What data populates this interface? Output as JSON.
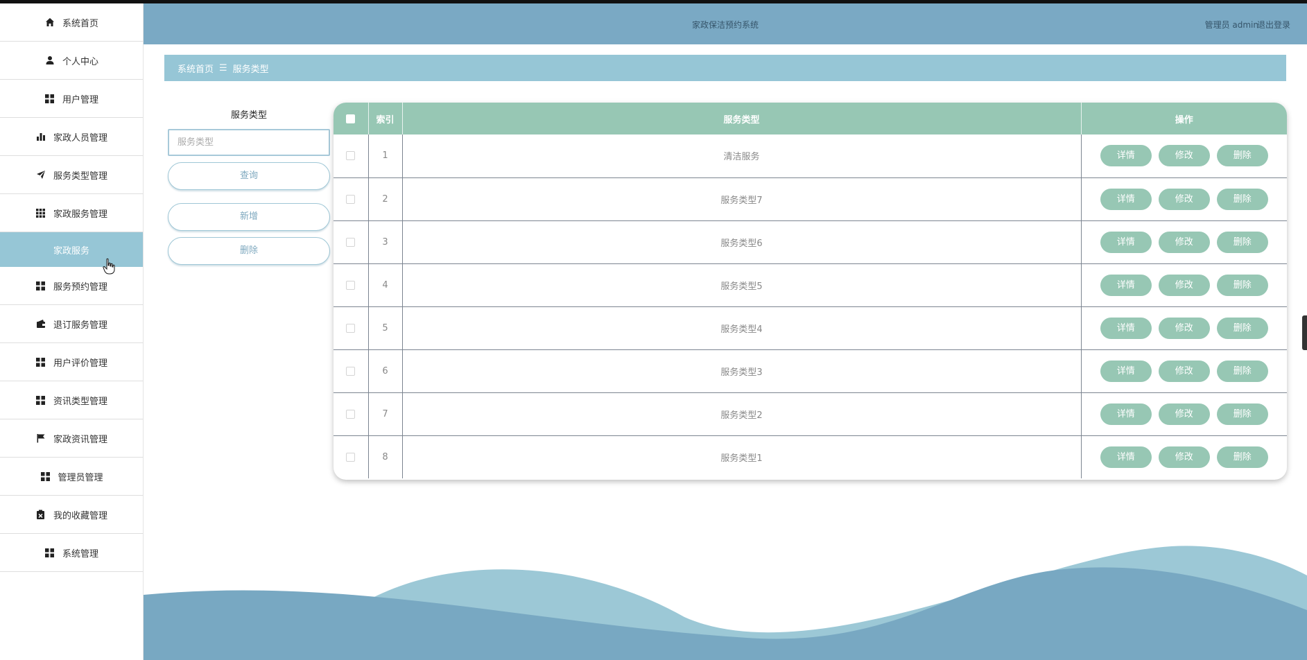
{
  "sidebar": {
    "items": [
      {
        "label": "系统首页",
        "icon": "home-icon"
      },
      {
        "label": "个人中心",
        "icon": "user-icon"
      },
      {
        "label": "用户管理",
        "icon": "grid-icon"
      },
      {
        "label": "家政人员管理",
        "icon": "bar-chart-icon"
      },
      {
        "label": "服务类型管理",
        "icon": "send-icon"
      },
      {
        "label": "家政服务管理",
        "icon": "grid9-icon"
      },
      {
        "label": "服务预约管理",
        "icon": "grid-icon"
      },
      {
        "label": "退订服务管理",
        "icon": "wallet-icon"
      },
      {
        "label": "用户评价管理",
        "icon": "grid-icon"
      },
      {
        "label": "资讯类型管理",
        "icon": "grid-icon"
      },
      {
        "label": "家政资讯管理",
        "icon": "flag-icon"
      },
      {
        "label": "管理员管理",
        "icon": "grid-icon"
      },
      {
        "label": "我的收藏管理",
        "icon": "clipboard-icon"
      },
      {
        "label": "系统管理",
        "icon": "grid-icon"
      }
    ],
    "submenu": {
      "label": "家政服务"
    }
  },
  "header": {
    "title": "家政保洁预约系统",
    "user": "管理员 admin",
    "logout": "退出登录"
  },
  "breadcrumb": {
    "home": "系统首页",
    "separator": "☰",
    "current": "服务类型"
  },
  "search": {
    "label": "服务类型",
    "placeholder": "服务类型",
    "query_label": "查询",
    "add_label": "新增",
    "delete_label": "删除"
  },
  "table": {
    "headers": {
      "index": "索引",
      "type": "服务类型",
      "actions": "操作"
    },
    "rows": [
      {
        "index": "1",
        "type": "清洁服务"
      },
      {
        "index": "2",
        "type": "服务类型7"
      },
      {
        "index": "3",
        "type": "服务类型6"
      },
      {
        "index": "4",
        "type": "服务类型5"
      },
      {
        "index": "5",
        "type": "服务类型4"
      },
      {
        "index": "6",
        "type": "服务类型3"
      },
      {
        "index": "7",
        "type": "服务类型2"
      },
      {
        "index": "8",
        "type": "服务类型1"
      }
    ],
    "actions": {
      "detail": "详情",
      "edit": "修改",
      "delete": "删除"
    }
  },
  "colors": {
    "header_bg": "#7aa9c4",
    "breadcrumb_bg": "#96c6d6",
    "table_head_bg": "#97c7b4",
    "wave_light": "#9cc8d6",
    "wave_dark": "#78a8c2"
  }
}
